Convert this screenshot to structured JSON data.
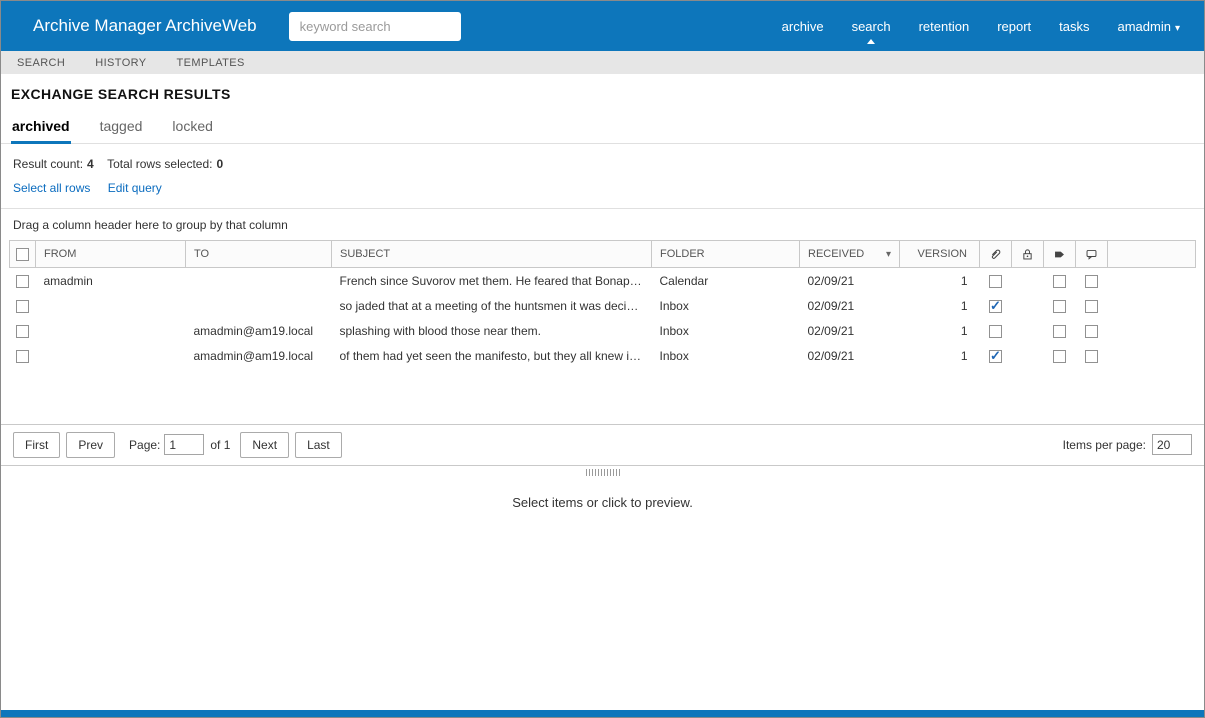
{
  "header": {
    "app_title": "Archive Manager ArchiveWeb",
    "search_placeholder": "keyword search",
    "nav": [
      {
        "label": "archive"
      },
      {
        "label": "search"
      },
      {
        "label": "retention"
      },
      {
        "label": "report"
      },
      {
        "label": "tasks"
      },
      {
        "label": "amadmin"
      }
    ]
  },
  "icons": {
    "user_menu_caret": "▾",
    "received_filter_caret": "▾"
  },
  "subnav": {
    "items": [
      "SEARCH",
      "HISTORY",
      "TEMPLATES"
    ]
  },
  "page": {
    "title": "EXCHANGE SEARCH RESULTS"
  },
  "tabs": [
    {
      "label": "archived"
    },
    {
      "label": "tagged"
    },
    {
      "label": "locked"
    }
  ],
  "results": {
    "result_count_label": "Result count:",
    "result_count": "4",
    "selected_label": "Total rows selected:",
    "selected_count": "0",
    "select_all_label": "Select all rows",
    "edit_query_label": "Edit query"
  },
  "groupbar": {
    "text": "Drag a column header here to group by that column"
  },
  "table": {
    "columns": {
      "from": "FROM",
      "to": "TO",
      "subject": "SUBJECT",
      "folder": "FOLDER",
      "received": "RECEIVED",
      "version": "VERSION"
    },
    "rows": [
      {
        "from": "amadmin",
        "to": "",
        "subject": "French since Suvorov met them. He feared that Bonapart…",
        "folder": "Calendar",
        "received": "02/09/21",
        "version": "1",
        "attachment": false,
        "tagged": false,
        "comment": false
      },
      {
        "from": "",
        "to": "",
        "subject": "so jaded that at a meeting of the huntsmen it was decide…",
        "folder": "Inbox",
        "received": "02/09/21",
        "version": "1",
        "attachment": true,
        "tagged": false,
        "comment": false
      },
      {
        "from": "",
        "to": "amadmin@am19.local",
        "subject": "splashing with blood those near them.",
        "folder": "Inbox",
        "received": "02/09/21",
        "version": "1",
        "attachment": false,
        "tagged": false,
        "comment": false
      },
      {
        "from": "",
        "to": "amadmin@am19.local",
        "subject": "of them had yet seen the manifesto, but they all knew it …",
        "folder": "Inbox",
        "received": "02/09/21",
        "version": "1",
        "attachment": true,
        "tagged": false,
        "comment": false
      }
    ]
  },
  "pagination": {
    "first": "First",
    "prev": "Prev",
    "page_label": "Page:",
    "page_value": "1",
    "of_label": "of 1",
    "next": "Next",
    "last": "Last",
    "items_per_page_label": "Items per page:",
    "items_per_page_value": "20"
  },
  "preview": {
    "message": "Select items or click to preview."
  }
}
